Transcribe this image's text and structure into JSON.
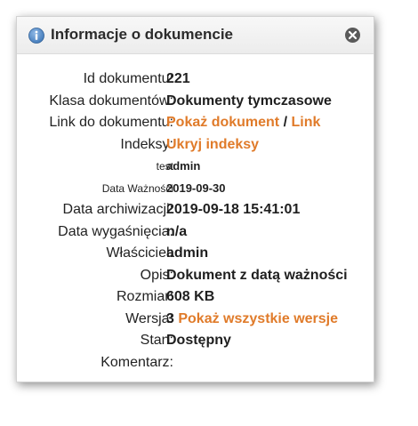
{
  "dialog": {
    "title": "Informacje o dokumencie",
    "icon": "info-icon",
    "close_icon": "close-icon"
  },
  "fields": {
    "id": {
      "label": "Id dokumentu:",
      "value": "221"
    },
    "klasa": {
      "label": "Klasa dokumentów:",
      "value": "Dokumenty tymczasowe"
    },
    "link": {
      "label": "Link do dokumentu:",
      "show_link": "Pokaż dokument",
      "separator": "/",
      "link": "Link"
    },
    "indeksy": {
      "label": "Indeksy:",
      "link": "Ukryj indeksy"
    },
    "test": {
      "label": "test",
      "value": "admin"
    },
    "data_waznosci": {
      "label": "Data Ważności",
      "value": "2019-09-30"
    },
    "data_archiwizacji": {
      "label": "Data archiwizacji:",
      "value": "2019-09-18 15:41:01"
    },
    "data_wygasniecia": {
      "label": "Data wygaśnięcia:",
      "value": "n/a"
    },
    "wlasciciel": {
      "label": "Właściciel:",
      "value": "admin"
    },
    "opis": {
      "label": "Opis:",
      "value": "Dokument z datą ważności"
    },
    "rozmiar": {
      "label": "Rozmiar:",
      "value": "608 KB"
    },
    "wersja": {
      "label": "Wersja:",
      "value": "3",
      "link": "Pokaż wszystkie wersje"
    },
    "stan": {
      "label": "Stan:",
      "value": "Dostępny"
    },
    "komentarz": {
      "label": "Komentarz:",
      "value": ""
    }
  },
  "colors": {
    "link": "#e07b2a",
    "info_icon": "#4a86c5",
    "close_icon": "#555555"
  }
}
